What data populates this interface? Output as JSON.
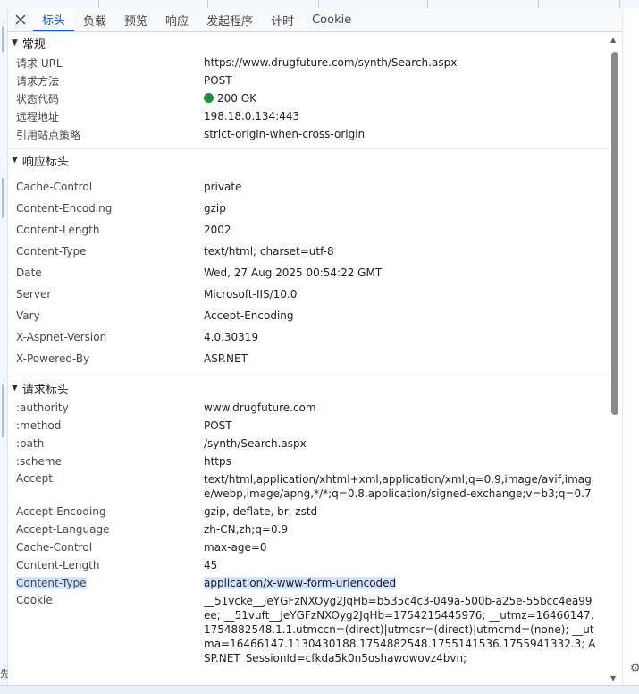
{
  "tabs": [
    {
      "label": "标头",
      "active": true
    },
    {
      "label": "负载"
    },
    {
      "label": "预览"
    },
    {
      "label": "响应"
    },
    {
      "label": "发起程序"
    },
    {
      "label": "计时"
    },
    {
      "label": "Cookie"
    }
  ],
  "general": {
    "title": "常规",
    "rows": [
      {
        "key": "请求 URL",
        "value": "https://www.drugfuture.com/synth/Search.aspx"
      },
      {
        "key": "请求方法",
        "value": "POST"
      },
      {
        "key": "状态代码",
        "value": "200 OK"
      },
      {
        "key": "远程地址",
        "value": "198.18.0.134:443"
      },
      {
        "key": "引用站点策略",
        "value": "strict-origin-when-cross-origin"
      }
    ]
  },
  "response_headers": {
    "title": "响应标头",
    "rows": [
      {
        "key": "Cache-Control",
        "value": "private"
      },
      {
        "key": "Content-Encoding",
        "value": "gzip"
      },
      {
        "key": "Content-Length",
        "value": "2002"
      },
      {
        "key": "Content-Type",
        "value": "text/html; charset=utf-8"
      },
      {
        "key": "Date",
        "value": "Wed, 27 Aug 2025 00:54:22 GMT"
      },
      {
        "key": "Server",
        "value": "Microsoft-IIS/10.0"
      },
      {
        "key": "Vary",
        "value": "Accept-Encoding"
      },
      {
        "key": "X-Aspnet-Version",
        "value": "4.0.30319"
      },
      {
        "key": "X-Powered-By",
        "value": "ASP.NET"
      }
    ]
  },
  "request_headers": {
    "title": "请求标头",
    "rows": [
      {
        "key": ":authority",
        "value": "www.drugfuture.com"
      },
      {
        "key": ":method",
        "value": "POST"
      },
      {
        "key": ":path",
        "value": "/synth/Search.aspx"
      },
      {
        "key": ":scheme",
        "value": "https"
      },
      {
        "key": "Accept",
        "value": "text/html,application/xhtml+xml,application/xml;q=0.9,image/avif,image/webp,image/apng,*/*;q=0.8,application/signed-exchange;v=b3;q=0.7"
      },
      {
        "key": "Accept-Encoding",
        "value": "gzip, deflate, br, zstd"
      },
      {
        "key": "Accept-Language",
        "value": "zh-CN,zh;q=0.9"
      },
      {
        "key": "Cache-Control",
        "value": "max-age=0"
      },
      {
        "key": "Content-Length",
        "value": "45"
      },
      {
        "key": "Content-Type",
        "value": "application/x-www-form-urlencoded"
      },
      {
        "key": "Cookie",
        "value": "__51vcke__JeYGFzNXOyg2JqHb=b535c4c3-049a-500b-a25e-55bcc4ea99ee; __51vuft__JeYGFzNXOyg2JqHb=1754215445976; __utmz=16466147.1754882548.1.1.utmccn=(direct)|utmcsr=(direct)|utmcmd=(none); __utma=16466147.1130430188.1754882548.1755141536.1755941332.3; ASP.NET_SessionId=cfkda5k0n5oshawowovz4bvn;"
      }
    ]
  },
  "left_gutter_char": "先"
}
